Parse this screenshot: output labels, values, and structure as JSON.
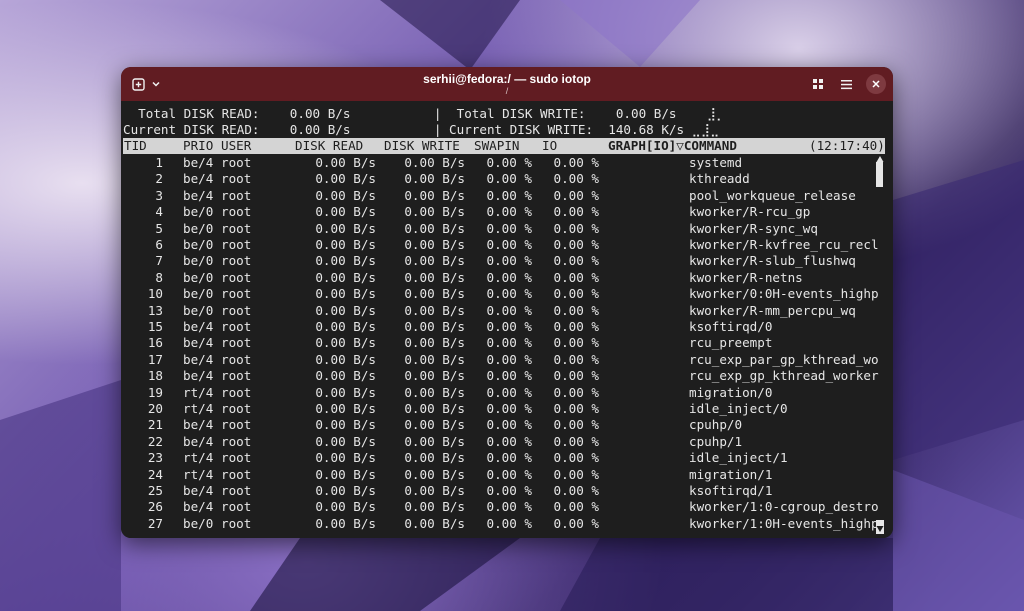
{
  "window": {
    "title": "serhii@fedora:/ — sudo iotop",
    "subtitle": "/",
    "new_tab_icon": "plus-square-icon",
    "menu_icon": "chevron-down-icon",
    "tab_overview_icon": "grid-icon",
    "hamburger_icon": "hamburger-menu-icon",
    "close_icon": "close-icon"
  },
  "summary": {
    "total_line": "  Total DISK READ:    0.00 B/s           |  Total DISK WRITE:    0.00 B/s    ⣸⡀",
    "current_line": "Current DISK READ:    0.00 B/s           | Current DISK WRITE:  140.68 K/s ⣀⣸⣀"
  },
  "table": {
    "columns": {
      "tid": "TID",
      "prio": "PRIO",
      "user": "USER",
      "disk_read": "DISK READ",
      "disk_write": "DISK WRITE",
      "swapin": "SWAPIN",
      "io": "IO",
      "graph_command": "GRAPH[IO]▽COMMAND",
      "clock": "(12:17:40)"
    },
    "rows": [
      {
        "tid": "1",
        "prio": "be/4",
        "user": "root",
        "read": "0.00 B/s",
        "write": "0.00 B/s",
        "swapin": "0.00 %",
        "io": "0.00 %",
        "command": "systemd"
      },
      {
        "tid": "2",
        "prio": "be/4",
        "user": "root",
        "read": "0.00 B/s",
        "write": "0.00 B/s",
        "swapin": "0.00 %",
        "io": "0.00 %",
        "command": "kthreadd"
      },
      {
        "tid": "3",
        "prio": "be/4",
        "user": "root",
        "read": "0.00 B/s",
        "write": "0.00 B/s",
        "swapin": "0.00 %",
        "io": "0.00 %",
        "command": "pool_workqueue_release"
      },
      {
        "tid": "4",
        "prio": "be/0",
        "user": "root",
        "read": "0.00 B/s",
        "write": "0.00 B/s",
        "swapin": "0.00 %",
        "io": "0.00 %",
        "command": "kworker/R-rcu_gp"
      },
      {
        "tid": "5",
        "prio": "be/0",
        "user": "root",
        "read": "0.00 B/s",
        "write": "0.00 B/s",
        "swapin": "0.00 %",
        "io": "0.00 %",
        "command": "kworker/R-sync_wq"
      },
      {
        "tid": "6",
        "prio": "be/0",
        "user": "root",
        "read": "0.00 B/s",
        "write": "0.00 B/s",
        "swapin": "0.00 %",
        "io": "0.00 %",
        "command": "kworker/R-kvfree_rcu_recl"
      },
      {
        "tid": "7",
        "prio": "be/0",
        "user": "root",
        "read": "0.00 B/s",
        "write": "0.00 B/s",
        "swapin": "0.00 %",
        "io": "0.00 %",
        "command": "kworker/R-slub_flushwq"
      },
      {
        "tid": "8",
        "prio": "be/0",
        "user": "root",
        "read": "0.00 B/s",
        "write": "0.00 B/s",
        "swapin": "0.00 %",
        "io": "0.00 %",
        "command": "kworker/R-netns"
      },
      {
        "tid": "10",
        "prio": "be/0",
        "user": "root",
        "read": "0.00 B/s",
        "write": "0.00 B/s",
        "swapin": "0.00 %",
        "io": "0.00 %",
        "command": "kworker/0:0H-events_highp"
      },
      {
        "tid": "13",
        "prio": "be/0",
        "user": "root",
        "read": "0.00 B/s",
        "write": "0.00 B/s",
        "swapin": "0.00 %",
        "io": "0.00 %",
        "command": "kworker/R-mm_percpu_wq"
      },
      {
        "tid": "15",
        "prio": "be/4",
        "user": "root",
        "read": "0.00 B/s",
        "write": "0.00 B/s",
        "swapin": "0.00 %",
        "io": "0.00 %",
        "command": "ksoftirqd/0"
      },
      {
        "tid": "16",
        "prio": "be/4",
        "user": "root",
        "read": "0.00 B/s",
        "write": "0.00 B/s",
        "swapin": "0.00 %",
        "io": "0.00 %",
        "command": "rcu_preempt"
      },
      {
        "tid": "17",
        "prio": "be/4",
        "user": "root",
        "read": "0.00 B/s",
        "write": "0.00 B/s",
        "swapin": "0.00 %",
        "io": "0.00 %",
        "command": "rcu_exp_par_gp_kthread_wo"
      },
      {
        "tid": "18",
        "prio": "be/4",
        "user": "root",
        "read": "0.00 B/s",
        "write": "0.00 B/s",
        "swapin": "0.00 %",
        "io": "0.00 %",
        "command": "rcu_exp_gp_kthread_worker"
      },
      {
        "tid": "19",
        "prio": "rt/4",
        "user": "root",
        "read": "0.00 B/s",
        "write": "0.00 B/s",
        "swapin": "0.00 %",
        "io": "0.00 %",
        "command": "migration/0"
      },
      {
        "tid": "20",
        "prio": "rt/4",
        "user": "root",
        "read": "0.00 B/s",
        "write": "0.00 B/s",
        "swapin": "0.00 %",
        "io": "0.00 %",
        "command": "idle_inject/0"
      },
      {
        "tid": "21",
        "prio": "be/4",
        "user": "root",
        "read": "0.00 B/s",
        "write": "0.00 B/s",
        "swapin": "0.00 %",
        "io": "0.00 %",
        "command": "cpuhp/0"
      },
      {
        "tid": "22",
        "prio": "be/4",
        "user": "root",
        "read": "0.00 B/s",
        "write": "0.00 B/s",
        "swapin": "0.00 %",
        "io": "0.00 %",
        "command": "cpuhp/1"
      },
      {
        "tid": "23",
        "prio": "rt/4",
        "user": "root",
        "read": "0.00 B/s",
        "write": "0.00 B/s",
        "swapin": "0.00 %",
        "io": "0.00 %",
        "command": "idle_inject/1"
      },
      {
        "tid": "24",
        "prio": "rt/4",
        "user": "root",
        "read": "0.00 B/s",
        "write": "0.00 B/s",
        "swapin": "0.00 %",
        "io": "0.00 %",
        "command": "migration/1"
      },
      {
        "tid": "25",
        "prio": "be/4",
        "user": "root",
        "read": "0.00 B/s",
        "write": "0.00 B/s",
        "swapin": "0.00 %",
        "io": "0.00 %",
        "command": "ksoftirqd/1"
      },
      {
        "tid": "26",
        "prio": "be/4",
        "user": "root",
        "read": "0.00 B/s",
        "write": "0.00 B/s",
        "swapin": "0.00 %",
        "io": "0.00 %",
        "command": "kworker/1:0-cgroup_destro"
      },
      {
        "tid": "27",
        "prio": "be/0",
        "user": "root",
        "read": "0.00 B/s",
        "write": "0.00 B/s",
        "swapin": "0.00 %",
        "io": "0.00 %",
        "command": "kworker/1:0H-events_highp"
      }
    ]
  },
  "colors": {
    "titlebar": "#611c22",
    "terminal_bg": "#1e1e1e",
    "terminal_fg": "#e6e6e6",
    "header_bg": "#d4d4d4"
  }
}
